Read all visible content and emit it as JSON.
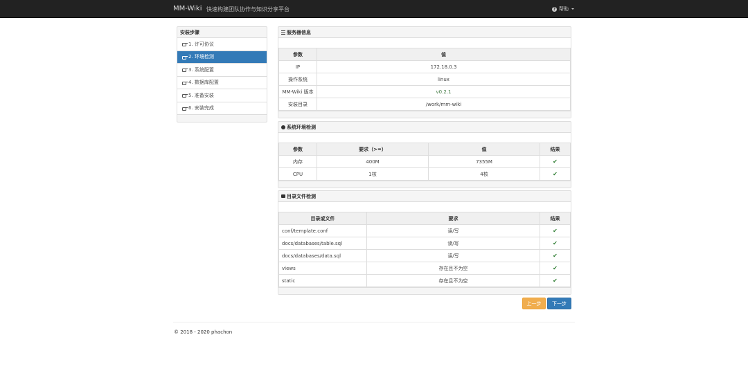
{
  "nav": {
    "brand": "MM-Wiki",
    "subtitle": "快速构建团队协作与知识分享平台",
    "help": "帮助"
  },
  "sidebar": {
    "title": "安装步骤",
    "items": [
      {
        "label": "1. 许可协议"
      },
      {
        "label": "2. 环境检测"
      },
      {
        "label": "3. 系统配置"
      },
      {
        "label": "4. 数据库配置"
      },
      {
        "label": "5. 准备安装"
      },
      {
        "label": "6. 安装完成"
      }
    ]
  },
  "server_info": {
    "title": "服务器信息",
    "headers": [
      "参数",
      "值"
    ],
    "rows": [
      {
        "k": "IP",
        "v": "172.18.0.3"
      },
      {
        "k": "操作系统",
        "v": "linux"
      },
      {
        "k": "MM-Wiki 版本",
        "v": "v0.2.1"
      },
      {
        "k": "安装目录",
        "v": "/work/mm-wiki"
      }
    ]
  },
  "env_check": {
    "title": "系统环境检测",
    "headers": [
      "参数",
      "要求（>=）",
      "值",
      "结果"
    ],
    "rows": [
      {
        "param": "内存",
        "req": "400M",
        "val": "7355M",
        "result": "✔"
      },
      {
        "param": "CPU",
        "req": "1核",
        "val": "4核",
        "result": "✔"
      }
    ]
  },
  "dir_check": {
    "title": "目录文件检测",
    "headers": [
      "目录或文件",
      "要求",
      "结果"
    ],
    "rows": [
      {
        "path": "conf/template.conf",
        "req": "读/写",
        "result": "✔"
      },
      {
        "path": "docs/databases/table.sql",
        "req": "读/写",
        "result": "✔"
      },
      {
        "path": "docs/databases/data.sql",
        "req": "读/写",
        "result": "✔"
      },
      {
        "path": "views",
        "req": "存在且不为空",
        "result": "✔"
      },
      {
        "path": "static",
        "req": "存在且不为空",
        "result": "✔"
      }
    ]
  },
  "buttons": {
    "prev": "上一步",
    "next": "下一步"
  },
  "footer": {
    "copyright": "© 2018 - 2020 phachon"
  }
}
